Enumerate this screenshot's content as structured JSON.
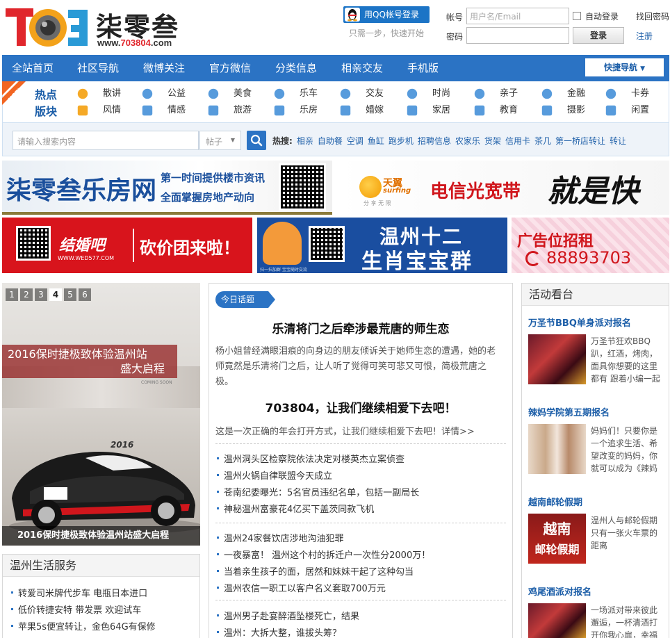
{
  "header": {
    "logo_number": "703",
    "logo_name": "柒零叁",
    "logo_url_prefix": "www.",
    "logo_url_domain": "703804",
    "logo_url_suffix": ".com",
    "qq_login": "用QQ帐号登录",
    "qq_tip": "只需一步，快速开始",
    "account_label": "帐号",
    "account_placeholder": "用户名/Email",
    "password_label": "密码",
    "auto_login": "自动登录",
    "forgot": "找回密码",
    "login_btn": "登录",
    "register": "注册"
  },
  "nav": {
    "items": [
      "全站首页",
      "社区导航",
      "微博关注",
      "官方微信",
      "分类信息",
      "相亲交友",
      "手机版"
    ],
    "quick_nav": "快捷导航"
  },
  "hot": {
    "ribbon": "HOT!",
    "title_line1": "热点",
    "title_line2": "版块",
    "items": [
      [
        "散讲",
        "风情"
      ],
      [
        "公益",
        "情感"
      ],
      [
        "美食",
        "旅游"
      ],
      [
        "乐车",
        "乐房"
      ],
      [
        "交友",
        "婚嫁"
      ],
      [
        "时尚",
        "家居"
      ],
      [
        "亲子",
        "教育"
      ],
      [
        "金融",
        "摄影"
      ],
      [
        "卡券",
        "闲置"
      ]
    ]
  },
  "search": {
    "placeholder": "请输入搜索内容",
    "type": "帖子",
    "hot_label": "热搜:",
    "keywords": [
      "相亲",
      "自助餐",
      "空调",
      "鱼缸",
      "跑步机",
      "招聘信息",
      "农家乐",
      "货架",
      "信用卡",
      "茶几",
      "第一桥店转让",
      "转让"
    ]
  },
  "banners": {
    "b1_title": "柒零叁乐房网",
    "b1_line1": "第一时间提供楼市资讯",
    "b1_line2": "全面掌握房地产动向",
    "b2_brand": "天翼",
    "b2_brand_en": "surfing",
    "b2_brand_sub": "分 享 无 限",
    "b2_text": "电信光宽带",
    "b2_slogan": "就是快",
    "b3_brand": "结婚吧",
    "b3_url": "WWW.WED577.COM",
    "b3_text": "砍价团来啦！",
    "b4_line1": "温州十二",
    "b4_line2": "生肖宝宝群",
    "b4_sub": "扫一扫加群 宝宝随时交流",
    "b5_line1": "广告位招租",
    "b5_phone": "88893703"
  },
  "slider": {
    "pages": [
      "1",
      "2",
      "3",
      "4",
      "5",
      "6"
    ],
    "active": "4",
    "banner_line1": "2016保时捷极致体验温州站",
    "banner_line2": "盛大启程",
    "caption": "2016保时捷极致体验温州站盛大启程",
    "car_number": "2016",
    "sign": "COMING SOON"
  },
  "life": {
    "title": "温州生活服务",
    "items": [
      "转爱司米牌代步车 电瓶日本进口",
      "低价转捷安特 带发票 欢迎试车",
      "苹果5s便宜转让，金色64G有保修"
    ]
  },
  "today": {
    "tag": "今日话题",
    "headline1": "乐清将门之后牵涉最荒唐的师生恋",
    "summary": "杨小姐曾经满眼泪痕的向身边的朋友倾诉关于她师生恋的遭遇，她的老师竟然是乐清将门之后，让人听了觉得可笑可悲又可恨，简极荒唐之极。",
    "headline2": "703804，让我们继续相爱下去吧！",
    "summary2": "这是一次正确的年会打开方式，让我们继续相爱下去吧！详情>>",
    "group1": [
      "温州洞头区检察院依法决定对楼英杰立案侦查",
      "温州火锅自律联盟今天成立",
      "苍南纪委曝光：5名官员违纪名单，包括一副局长",
      "神秘温州富豪花4亿买下盖茨同款飞机"
    ],
    "group2": [
      "温州24家餐饮店涉地沟油犯罪",
      "一夜暴富！ 温州这个村的拆迁户一次性分2000万！",
      "当着亲生孩子的面，居然和妹妹干起了这种勾当",
      "温州农信一职工以客户名义套取700万元"
    ],
    "group3": [
      "温州男子赴宴醉酒坠楼死亡，结果",
      "温州：大拆大整，谁拔头筹？"
    ]
  },
  "activity": {
    "title": "活动看台",
    "items": [
      {
        "title": "万圣节BBQ单身派对报名",
        "text": "万圣节狂欢BBQ趴，红酒，烤肉，面具你想要的这里都有 跟着小编一起"
      },
      {
        "title": "辣妈学院第五期报名",
        "text": "妈妈们！只要你是一个追求生活、希望改变的妈妈，你就可以成为《辣妈"
      },
      {
        "title": "越南邮轮假期",
        "text": "温州人与邮轮假期只有一张火车票的距离",
        "img_line1": "越南",
        "img_line2": "邮轮假期"
      },
      {
        "title": "鸡尾酒派对报名",
        "text": "一场派对带来彼此邂逅，一杯清酒打开你我心扉，幸福"
      }
    ]
  }
}
